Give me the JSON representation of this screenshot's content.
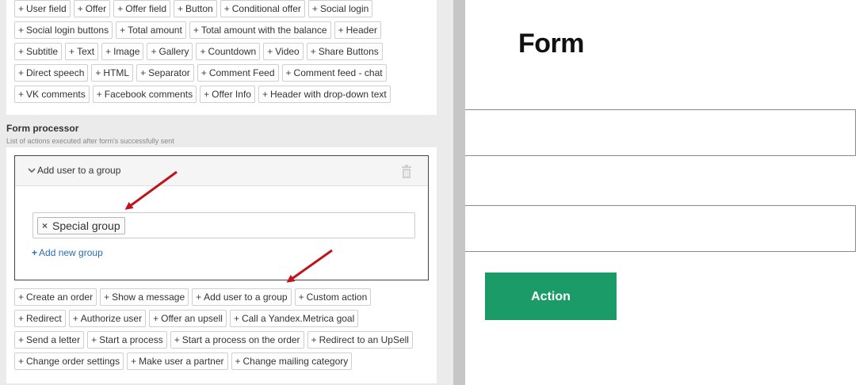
{
  "editor": {
    "field_buttons": [
      [
        "User field",
        "Offer",
        "Offer field",
        "Button",
        "Conditional offer",
        "Social login"
      ],
      [
        "Social login buttons",
        "Total amount",
        "Total amount with the balance",
        "Header"
      ],
      [
        "Subtitle",
        "Text",
        "Image",
        "Gallery",
        "Countdown",
        "Video",
        "Share Buttons"
      ],
      [
        "Direct speech",
        "HTML",
        "Separator",
        "Comment Feed",
        "Comment feed - chat"
      ],
      [
        "VK comments",
        "Facebook comments",
        "Offer Info",
        "Header with drop-down text"
      ]
    ],
    "form_processor": {
      "title": "Form processor",
      "subtitle": "List of actions executed after form's successfully sent",
      "action": {
        "title": "Add user to a group",
        "tag": "Special group",
        "add_group_label": "Add new group"
      },
      "action_buttons": [
        [
          "Create an order",
          "Show a message",
          "Add user to a group",
          "Custom action"
        ],
        [
          "Redirect",
          "Authorize user",
          "Offer an upsell",
          "Call a Yandex.Metrica goal"
        ],
        [
          "Send a letter",
          "Start a process",
          "Start a process on the order",
          "Redirect to an UpSell"
        ],
        [
          "Change order settings",
          "Make user a partner",
          "Change mailing category"
        ]
      ]
    },
    "icons": {
      "collapse": "chevron-down-icon",
      "delete": "trash-icon",
      "remove_tag": "close-icon",
      "add": "plus-icon"
    }
  },
  "preview": {
    "title": "Form",
    "action_button": "Action",
    "accent_color": "#1a9b68"
  },
  "annotation_color": "#c0141a"
}
